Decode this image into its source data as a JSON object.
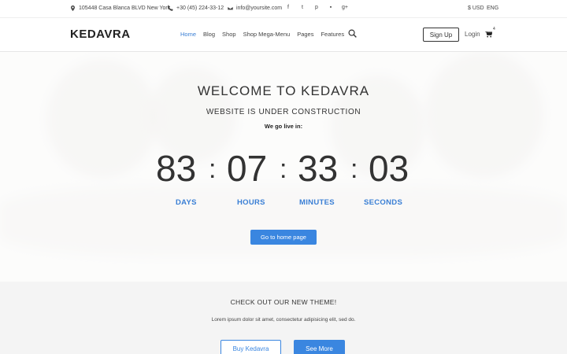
{
  "topbar": {
    "address": "105448 Casa Blanca BLVD New York",
    "phone": "+30 (45) 224-33-12",
    "email": "info@yoursite.com",
    "social": [
      {
        "icon": "facebook-icon",
        "glyph": "f"
      },
      {
        "icon": "twitter-icon",
        "glyph": "t"
      },
      {
        "icon": "pinterest-icon",
        "glyph": "p"
      },
      {
        "icon": "flickr-icon",
        "glyph": "▪"
      },
      {
        "icon": "googleplus-icon",
        "glyph": "g+"
      }
    ],
    "currency": "$ USD",
    "language": "ENG"
  },
  "header": {
    "logo": "KEDAVRA",
    "nav": [
      "Home",
      "Blog",
      "Shop",
      "Shop Mega-Menu",
      "Pages",
      "Features"
    ],
    "active_nav": "Home",
    "signup": "Sign Up",
    "login": "Login",
    "cart_count": "4"
  },
  "hero": {
    "title": "WELCOME TO KEDAVRA",
    "subtitle": "WEBSITE IS UNDER CONSTRUCTION",
    "golive": "We go live in:",
    "countdown": {
      "days": "83",
      "hours": "07",
      "minutes": "33",
      "seconds": "03",
      "separator": ":",
      "days_label": "DAYS",
      "hours_label": "HOURS",
      "minutes_label": "MINUTES",
      "seconds_label": "SECONDS"
    },
    "button": "Go to home page"
  },
  "promo": {
    "title": "CHECK OUT OUR NEW THEME!",
    "text": "Lorem ipsum dolor sit amet, consectetur adipisicing elit, sed do.",
    "buy_button": "Buy Kedavra",
    "more_button": "See More"
  },
  "colors": {
    "accent": "#3a86e0",
    "text": "#333333"
  }
}
